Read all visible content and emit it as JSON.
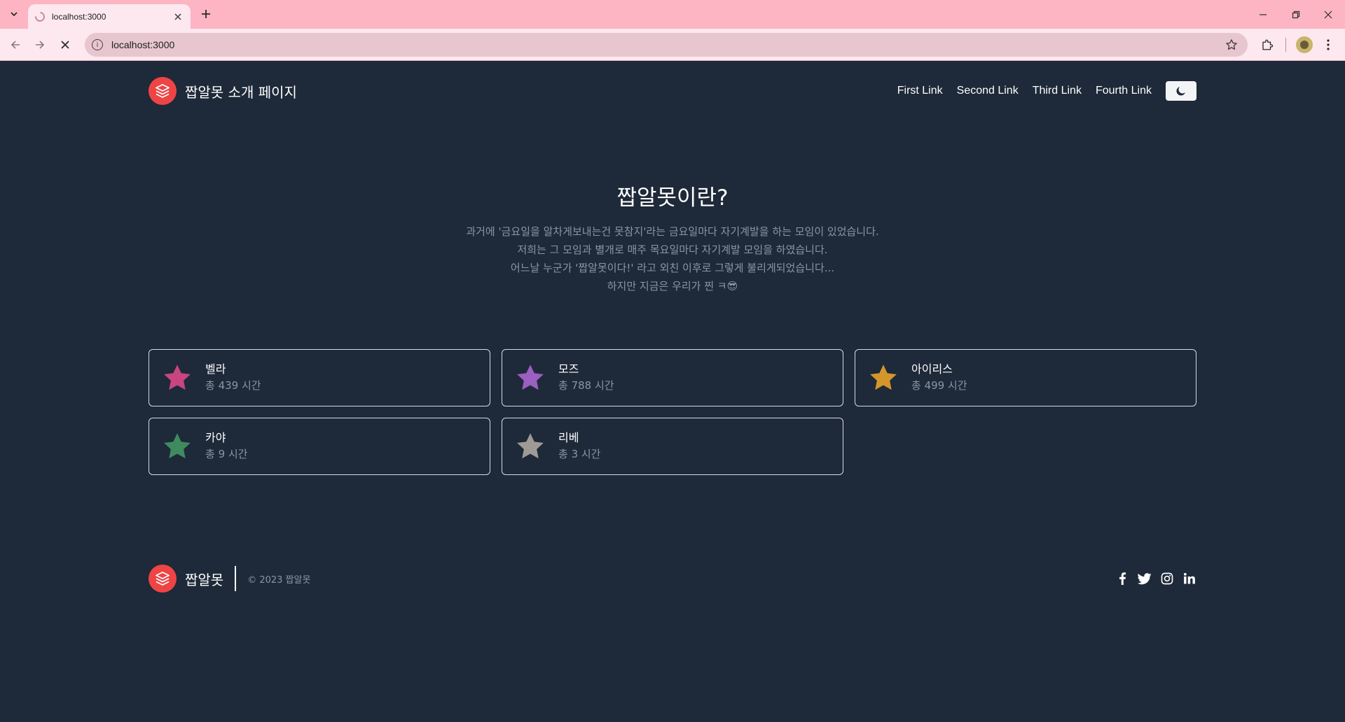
{
  "browser": {
    "tab_title": "localhost:3000",
    "url": "localhost:3000",
    "colors": {
      "frame": "#fdb4c3",
      "toolbar": "#fce8ee",
      "omnibox": "#e7c6cf"
    }
  },
  "header": {
    "brand": "짭알못 소개 페이지",
    "nav": [
      "First Link",
      "Second Link",
      "Third Link",
      "Fourth Link"
    ],
    "theme_toggle_icon": "moon-icon"
  },
  "hero": {
    "title": "짭알못이란?",
    "lines": [
      "과거에 '금요일을 알차게보내는건 못참지'라는 금요일마다 자기계발을 하는 모임이 있었습니다.",
      "저희는 그 모임과 별개로 매주 목요일마다 자기계발 모임을 하였습니다.",
      "어느날 누군가 '짭알못이다!' 라고 외친 이후로 그렇게 불리게되었습니다...",
      "하지만 지금은 우리가 찐 ㅋ😎"
    ]
  },
  "members": [
    {
      "name": "벨라",
      "hours": "총 439 시간",
      "color": "#c8457f"
    },
    {
      "name": "모즈",
      "hours": "총 788 시간",
      "color": "#9b5fc0"
    },
    {
      "name": "아이리스",
      "hours": "총 499 시간",
      "color": "#d4962a"
    },
    {
      "name": "카야",
      "hours": "총 9 시간",
      "color": "#3f8a5f"
    },
    {
      "name": "리베",
      "hours": "총 3 시간",
      "color": "#a09a94"
    }
  ],
  "footer": {
    "brand": "짭알못",
    "copyright": "© 2023 짭알못",
    "social": [
      "facebook-icon",
      "twitter-icon",
      "instagram-icon",
      "linkedin-icon"
    ]
  },
  "colors": {
    "background": "#1e2939",
    "accent": "#ef4444",
    "muted_text": "#8b95a5"
  }
}
